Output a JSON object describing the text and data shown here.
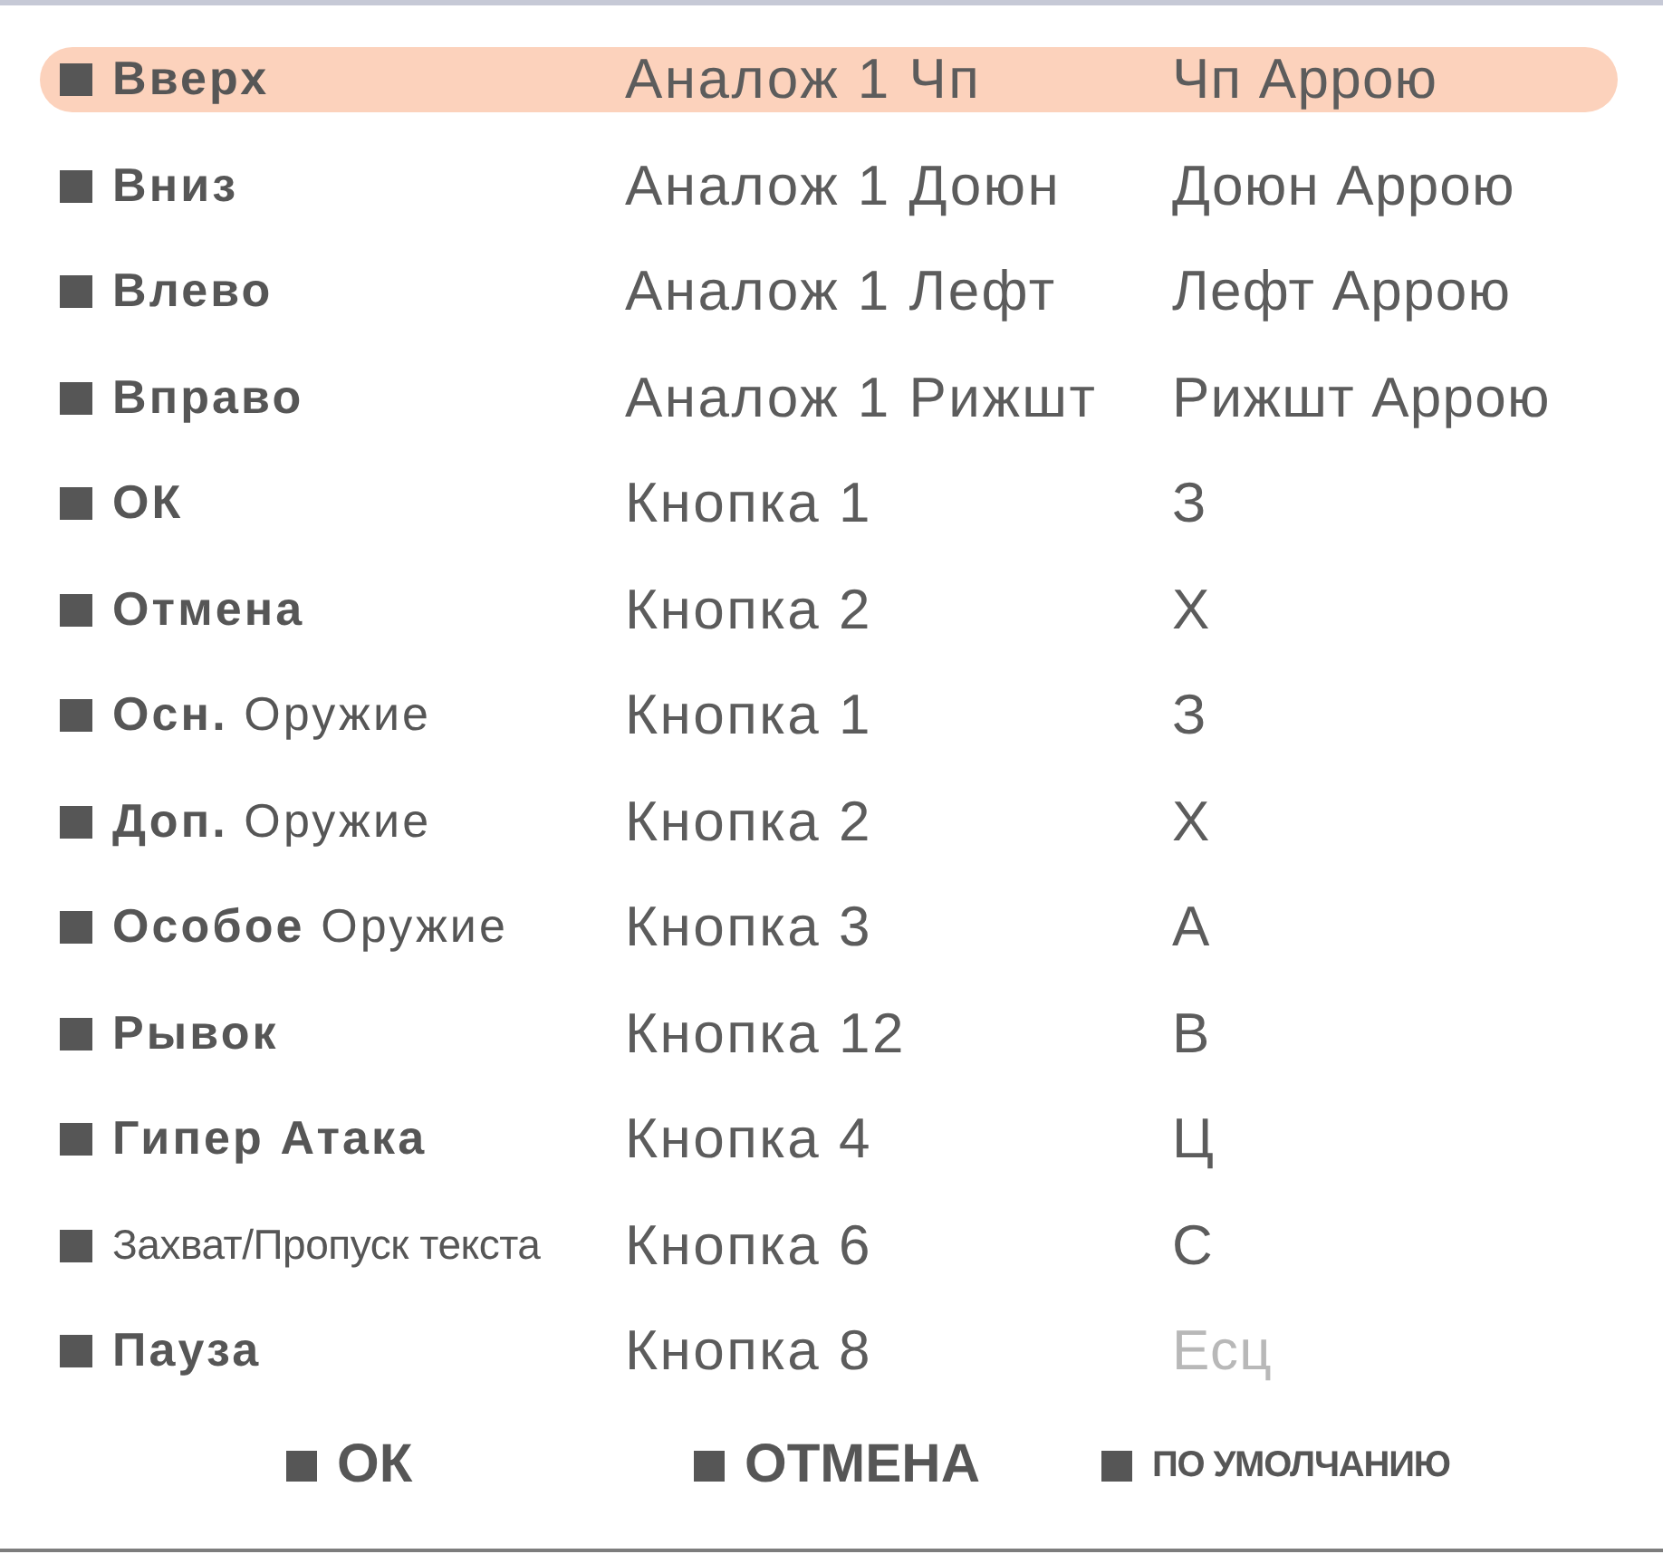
{
  "rows": [
    {
      "action": "Вверх",
      "kind": "bold",
      "binding_1": "Аналож 1 Чп",
      "binding_2": "Чп Аррою",
      "binding_2_dimmed": false,
      "selected": true
    },
    {
      "action": "Вниз",
      "kind": "bold",
      "binding_1": "Аналож 1 Доюн",
      "binding_2": "Доюн Аррою",
      "binding_2_dimmed": false,
      "selected": false
    },
    {
      "action": "Влево",
      "kind": "bold",
      "binding_1": "Аналож 1 Лефт",
      "binding_2": "Лефт Аррою",
      "binding_2_dimmed": false,
      "selected": false
    },
    {
      "action": "Вправо",
      "kind": "bold",
      "binding_1": "Аналож 1 Рижшт",
      "binding_2": "Рижшт Аррою",
      "binding_2_dimmed": false,
      "selected": false
    },
    {
      "action": "ОК",
      "kind": "bold",
      "binding_1": "Кнопка 1",
      "binding_2": "З",
      "binding_2_dimmed": false,
      "selected": false
    },
    {
      "action": "Отмена",
      "kind": "bold",
      "binding_1": "Кнопка 2",
      "binding_2": "Х",
      "binding_2_dimmed": false,
      "selected": false
    },
    {
      "action": "**Осн.** Оружие",
      "kind": "mixed",
      "binding_1": "Кнопка 1",
      "binding_2": "З",
      "binding_2_dimmed": false,
      "selected": false
    },
    {
      "action": "**Доп.** Оружие",
      "kind": "mixed",
      "binding_1": "Кнопка 2",
      "binding_2": "Х",
      "binding_2_dimmed": false,
      "selected": false
    },
    {
      "action": "**Особое** Оружие",
      "kind": "mixed",
      "binding_1": "Кнопка 3",
      "binding_2": "А",
      "binding_2_dimmed": false,
      "selected": false
    },
    {
      "action": "Рывок",
      "kind": "bold",
      "binding_1": "Кнопка 12",
      "binding_2": "В",
      "binding_2_dimmed": false,
      "selected": false
    },
    {
      "action": "Гипер Атака",
      "kind": "bold",
      "binding_1": "Кнопка 4",
      "binding_2": "Ц",
      "binding_2_dimmed": false,
      "selected": false
    },
    {
      "action": "Захват/Пропуск текста",
      "kind": "condensed",
      "binding_1": "Кнопка 6",
      "binding_2": "С",
      "binding_2_dimmed": false,
      "selected": false
    },
    {
      "action": "Пауза",
      "kind": "bold",
      "binding_1": "Кнопка 8",
      "binding_2": "Есц",
      "binding_2_dimmed": true,
      "selected": false
    }
  ],
  "buttons": [
    {
      "label": "ОК",
      "kind": "bold"
    },
    {
      "label": "ОТМЕНА",
      "kind": "bold"
    },
    {
      "label": "ПО УМОЛЧАНИЮ",
      "kind": "condensed"
    }
  ]
}
